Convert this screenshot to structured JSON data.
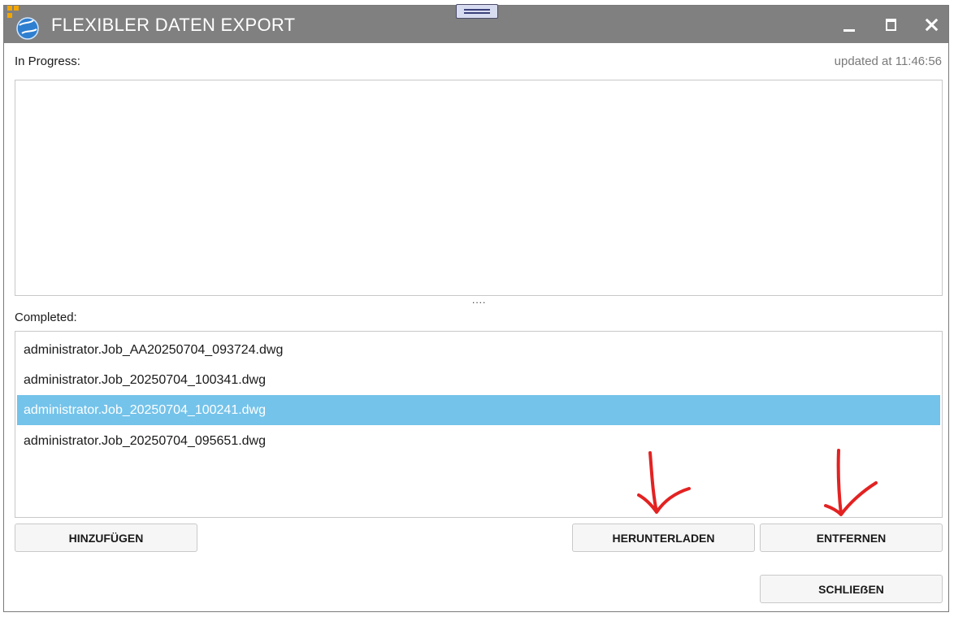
{
  "window": {
    "title": "FLEXIBLER DATEN EXPORT",
    "app_icon": "globe-app-icon",
    "controls": [
      "minimize-icon",
      "maximize-icon",
      "close-icon"
    ]
  },
  "in_progress": {
    "label": "In Progress:",
    "updated": "updated at 11:46:56",
    "items": []
  },
  "splitter": "....",
  "completed": {
    "label": "Completed:",
    "items": [
      "administrator.Job_AA20250704_093724.dwg",
      "administrator.Job_20250704_100341.dwg",
      "administrator.Job_20250704_100241.dwg",
      "administrator.Job_20250704_095651.dwg"
    ],
    "selected_index": 2
  },
  "buttons": {
    "add": "HINZUFÜGEN",
    "download": "HERUNTERLADEN",
    "remove": "ENTFERNEN",
    "close": "SCHLIEẞEN"
  },
  "colors": {
    "titlebar": "#808080",
    "selection": "#74c3ea",
    "annotation_arrows": "#e32222"
  }
}
